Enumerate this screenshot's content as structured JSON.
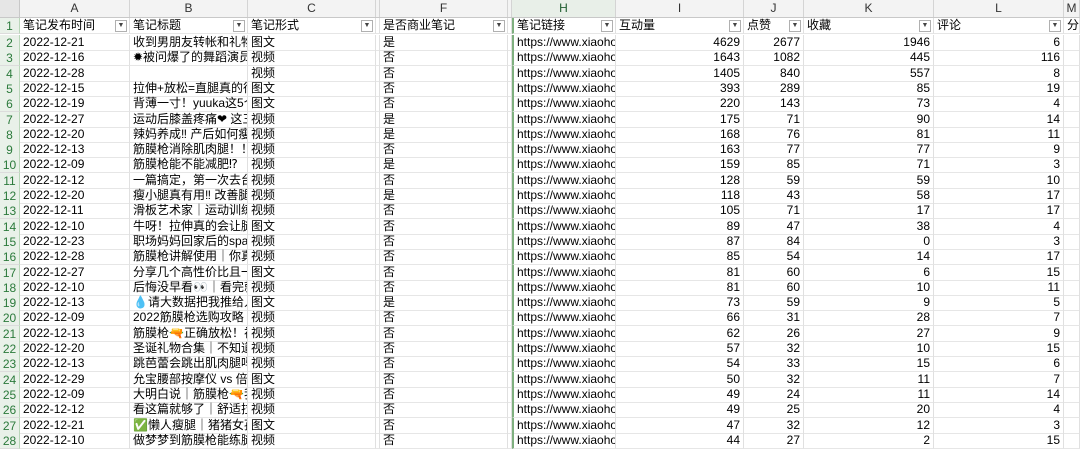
{
  "columns": [
    "A",
    "B",
    "C",
    "",
    "F",
    "",
    "H",
    "I",
    "J",
    "K",
    "L",
    "M"
  ],
  "headers": [
    "笔记发布时间",
    "笔记标题",
    "笔记形式",
    "是否商业笔记",
    "笔记链接",
    "互动量",
    "点赞",
    "收藏",
    "评论",
    "分享"
  ],
  "rows": [
    {
      "n": "2",
      "a": "2022-12-21",
      "b": "收到男朋友转帐和礼物",
      "c": "图文",
      "f": "是",
      "h": "https://www.xiaohon",
      "i": "4629",
      "j": "2677",
      "k": "1946",
      "l": "6"
    },
    {
      "n": "3",
      "a": "2022-12-16",
      "b": "✹被问爆了的舞蹈演员",
      "c": "视频",
      "f": "否",
      "h": "https://www.xiaohon",
      "i": "1643",
      "j": "1082",
      "k": "445",
      "l": "116"
    },
    {
      "n": "4",
      "a": "2022-12-28",
      "b": "",
      "c": "视频",
      "f": "否",
      "h": "https://www.xiaohon",
      "i": "1405",
      "j": "840",
      "k": "557",
      "l": "8"
    },
    {
      "n": "5",
      "a": "2022-12-15",
      "b": "拉伸+放松=直腿真的很",
      "c": "图文",
      "f": "否",
      "h": "https://www.xiaohon",
      "i": "393",
      "j": "289",
      "k": "85",
      "l": "19"
    },
    {
      "n": "6",
      "a": "2022-12-19",
      "b": "背薄一寸！yuuka这5个",
      "c": "图文",
      "f": "否",
      "h": "https://www.xiaohon",
      "i": "220",
      "j": "143",
      "k": "73",
      "l": "4"
    },
    {
      "n": "7",
      "a": "2022-12-27",
      "b": "运动后膝盖疼痛❤ 这三",
      "c": "视频",
      "f": "是",
      "h": "https://www.xiaohon",
      "i": "175",
      "j": "71",
      "k": "90",
      "l": "14"
    },
    {
      "n": "8",
      "a": "2022-12-20",
      "b": "辣妈养成‼ 产后如何瘦",
      "c": "视频",
      "f": "是",
      "h": "https://www.xiaohon",
      "i": "168",
      "j": "76",
      "k": "81",
      "l": "11"
    },
    {
      "n": "9",
      "a": "2022-12-13",
      "b": "筋膜枪消除肌肉腿！！",
      "c": "视频",
      "f": "否",
      "h": "https://www.xiaohon",
      "i": "163",
      "j": "77",
      "k": "77",
      "l": "9"
    },
    {
      "n": "10",
      "a": "2022-12-09",
      "b": "筋膜枪能不能减肥⁉",
      "c": "视频",
      "f": "是",
      "h": "https://www.xiaohon",
      "i": "159",
      "j": "85",
      "k": "71",
      "l": "3"
    },
    {
      "n": "11",
      "a": "2022-12-12",
      "b": "一篇搞定，第一次去台",
      "c": "视频",
      "f": "否",
      "h": "https://www.xiaohon",
      "i": "128",
      "j": "59",
      "k": "59",
      "l": "10"
    },
    {
      "n": "12",
      "a": "2022-12-20",
      "b": "瘦小腿真有用‼ 改善腿",
      "c": "视频",
      "f": "是",
      "h": "https://www.xiaohon",
      "i": "118",
      "j": "43",
      "k": "58",
      "l": "17"
    },
    {
      "n": "13",
      "a": "2022-12-11",
      "b": "滑板艺术家｜运动训练",
      "c": "视频",
      "f": "否",
      "h": "https://www.xiaohon",
      "i": "105",
      "j": "71",
      "k": "17",
      "l": "17"
    },
    {
      "n": "14",
      "a": "2022-12-10",
      "b": "牛呀！拉伸真的会让腿",
      "c": "图文",
      "f": "否",
      "h": "https://www.xiaohon",
      "i": "89",
      "j": "47",
      "k": "38",
      "l": "4"
    },
    {
      "n": "15",
      "a": "2022-12-23",
      "b": "职场妈妈回家后的spa",
      "c": "视频",
      "f": "否",
      "h": "https://www.xiaohon",
      "i": "87",
      "j": "84",
      "k": "0",
      "l": "3"
    },
    {
      "n": "16",
      "a": "2022-12-28",
      "b": "筋膜枪讲解使用｜你真",
      "c": "视频",
      "f": "否",
      "h": "https://www.xiaohon",
      "i": "85",
      "j": "54",
      "k": "14",
      "l": "17"
    },
    {
      "n": "17",
      "a": "2022-12-27",
      "b": "分享几个高性价比且一",
      "c": "图文",
      "f": "否",
      "h": "https://www.xiaohon",
      "i": "81",
      "j": "60",
      "k": "6",
      "l": "15"
    },
    {
      "n": "18",
      "a": "2022-12-10",
      "b": "后悔没早看👀｜看完就",
      "c": "视频",
      "f": "否",
      "h": "https://www.xiaohon",
      "i": "81",
      "j": "60",
      "k": "10",
      "l": "11"
    },
    {
      "n": "19",
      "a": "2022-12-13",
      "b": "💧请大数据把我推给人",
      "c": "图文",
      "f": "是",
      "h": "https://www.xiaohon",
      "i": "73",
      "j": "59",
      "k": "9",
      "l": "5"
    },
    {
      "n": "20",
      "a": "2022-12-09",
      "b": "2022筋膜枪选购攻略",
      "c": "视频",
      "f": "否",
      "h": "https://www.xiaohon",
      "i": "66",
      "j": "31",
      "k": "28",
      "l": "7"
    },
    {
      "n": "21",
      "a": "2022-12-13",
      "b": "筋膜枪🔫正确放松！视",
      "c": "视频",
      "f": "否",
      "h": "https://www.xiaohon",
      "i": "62",
      "j": "26",
      "k": "27",
      "l": "9"
    },
    {
      "n": "22",
      "a": "2022-12-20",
      "b": "圣诞礼物合集｜不知道",
      "c": "视频",
      "f": "否",
      "h": "https://www.xiaohon",
      "i": "57",
      "j": "32",
      "k": "10",
      "l": "15"
    },
    {
      "n": "23",
      "a": "2022-12-13",
      "b": "跳芭蕾会跳出肌肉腿吗",
      "c": "视频",
      "f": "否",
      "h": "https://www.xiaohon",
      "i": "54",
      "j": "33",
      "k": "15",
      "l": "6"
    },
    {
      "n": "24",
      "a": "2022-12-29",
      "b": "允宝腰部按摩仪 vs 倍",
      "c": "图文",
      "f": "否",
      "h": "https://www.xiaohon",
      "i": "50",
      "j": "32",
      "k": "11",
      "l": "7"
    },
    {
      "n": "25",
      "a": "2022-12-09",
      "b": "大明白说｜筋膜枪🔫我",
      "c": "视频",
      "f": "否",
      "h": "https://www.xiaohon",
      "i": "49",
      "j": "24",
      "k": "11",
      "l": "14"
    },
    {
      "n": "26",
      "a": "2022-12-12",
      "b": "看这篇就够了｜舒适拉",
      "c": "视频",
      "f": "否",
      "h": "https://www.xiaohon",
      "i": "49",
      "j": "25",
      "k": "20",
      "l": "4"
    },
    {
      "n": "27",
      "a": "2022-12-21",
      "b": "✅懒人瘦腿｜猪猪女孩",
      "c": "图文",
      "f": "否",
      "h": "https://www.xiaohon",
      "i": "47",
      "j": "32",
      "k": "12",
      "l": "3"
    },
    {
      "n": "28",
      "a": "2022-12-10",
      "b": "做梦梦到筋膜枪能练腿",
      "c": "视频",
      "f": "否",
      "h": "https://www.xiaohon",
      "i": "44",
      "j": "27",
      "k": "2",
      "l": "15"
    }
  ]
}
